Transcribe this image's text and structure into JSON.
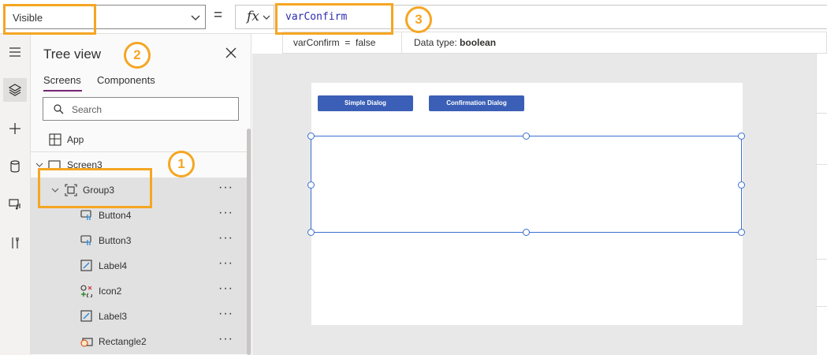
{
  "formula_bar": {
    "property": "Visible",
    "equals": "=",
    "fx": "fx",
    "formula": "varConfirm",
    "result": "varConfirm  =  false",
    "data_type_label": "Data type:",
    "data_type_value": "boolean"
  },
  "tree_view": {
    "title": "Tree view",
    "tabs": [
      {
        "label": "Screens",
        "active": true
      },
      {
        "label": "Components",
        "active": false
      }
    ],
    "search_placeholder": "Search",
    "app_label": "App",
    "nodes": [
      {
        "label": "Screen3"
      },
      {
        "label": "Group3",
        "selected": true
      },
      {
        "label": "Button4"
      },
      {
        "label": "Button3"
      },
      {
        "label": "Label4"
      },
      {
        "label": "Icon2"
      },
      {
        "label": "Label3"
      },
      {
        "label": "Rectangle2"
      }
    ],
    "more": "···"
  },
  "canvas": {
    "buttons": [
      "Simple Dialog",
      "Confirmation Dialog"
    ]
  },
  "callouts": [
    "1",
    "2",
    "3"
  ],
  "colors": {
    "accent": "#742774",
    "callout": "#f5a623",
    "app_button": "#3b5fb6",
    "selection": "#3b6fd1"
  }
}
